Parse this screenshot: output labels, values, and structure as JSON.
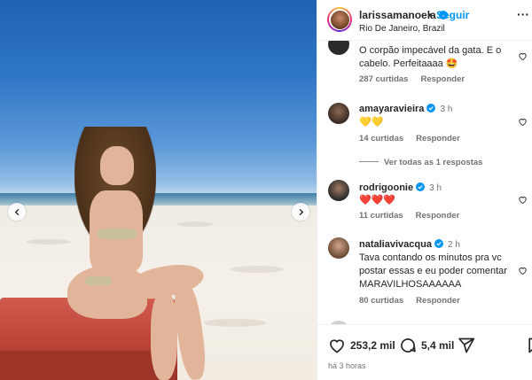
{
  "header": {
    "username": "larissamanoela",
    "separator": "•",
    "follow_label": "Seguir",
    "location": "Rio De Janeiro, Brazil",
    "more_label": "···"
  },
  "comments": [
    {
      "user": "",
      "time": "",
      "text": "O corpão impecável da gata. E o cabelo. Perfeitaaaa 🤩",
      "likes": "287 curtidas",
      "reply": "Responder"
    },
    {
      "user": "amayaravieira",
      "time": "3 h",
      "text": "💛💛",
      "likes": "14 curtidas",
      "reply": "Responder",
      "view_replies": "Ver todas as 1 respostas"
    },
    {
      "user": "rodrigoonie",
      "time": "3 h",
      "text": "❤️❤️❤️",
      "likes": "11 curtidas",
      "reply": "Responder"
    },
    {
      "user": "nataliavivacqua",
      "time": "2 h",
      "text": "Tava contando os minutos pra vc postar essas e eu poder comentar MARAVILHOSAAAAAA",
      "likes": "80 curtidas",
      "reply": "Responder"
    }
  ],
  "actions": {
    "likes_count": "253,2 mil",
    "comments_count": "5,4 mil"
  },
  "post_time": "há 3 horas",
  "colors": {
    "accent": "#0095f6",
    "verified": "#0095f6",
    "muted": "#737373",
    "text": "#262626"
  }
}
